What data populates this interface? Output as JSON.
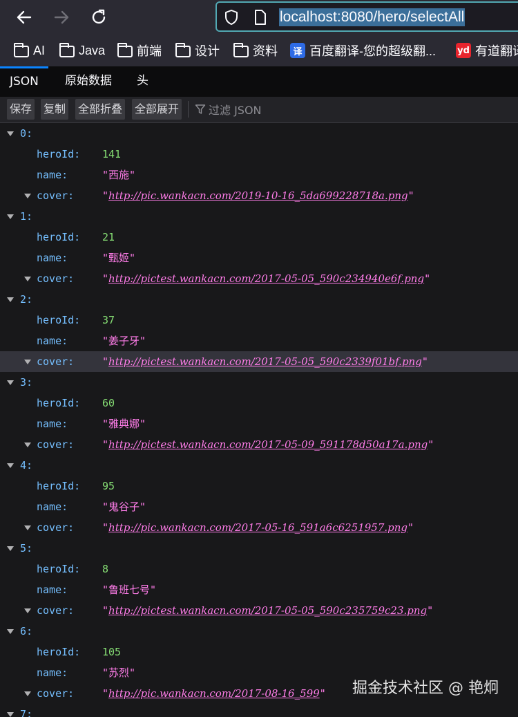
{
  "browser": {
    "url": "localhost:8080/hero/selectAll",
    "bookmarks": [
      {
        "label": "AI",
        "icon": "folder-icon"
      },
      {
        "label": "Java",
        "icon": "folder-icon"
      },
      {
        "label": "前端",
        "icon": "folder-icon"
      },
      {
        "label": "设计",
        "icon": "folder-icon"
      },
      {
        "label": "资料",
        "icon": "folder-icon"
      },
      {
        "label": "百度翻译-您的超级翻...",
        "icon": "baidu-translate-icon",
        "icon_text": "译",
        "color": "#2e6be6"
      },
      {
        "label": "有道翻译",
        "icon": "youdao-icon",
        "icon_text": "yd",
        "color": "#e8242d"
      }
    ]
  },
  "viewer": {
    "tabs": [
      "JSON",
      "原始数据",
      "头"
    ],
    "toolbar": {
      "save": "保存",
      "copy": "复制",
      "collapse_all": "全部折叠",
      "expand_all": "全部展开",
      "filter_placeholder": "过滤 JSON"
    },
    "key_labels": {
      "hero_id": "heroId:",
      "name": "name:",
      "cover": "cover:"
    },
    "entries": [
      {
        "index": "0:",
        "heroId": "141",
        "name": "\"西施\"",
        "cover": "http://pic.wankacn.com/2019-10-16_5da699228718a.png"
      },
      {
        "index": "1:",
        "heroId": "21",
        "name": "\"甄姬\"",
        "cover": "http://pictest.wankacn.com/2017-05-05_590c234940e6f.png"
      },
      {
        "index": "2:",
        "heroId": "37",
        "name": "\"姜子牙\"",
        "cover": "http://pictest.wankacn.com/2017-05-05_590c2339f01bf.png"
      },
      {
        "index": "3:",
        "heroId": "60",
        "name": "\"雅典娜\"",
        "cover": "http://pictest.wankacn.com/2017-05-09_591178d50a17a.png"
      },
      {
        "index": "4:",
        "heroId": "95",
        "name": "\"鬼谷子\"",
        "cover": "http://pic.wankacn.com/2017-05-16_591a6c6251957.png"
      },
      {
        "index": "5:",
        "heroId": "8",
        "name": "\"鲁班七号\"",
        "cover": "http://pictest.wankacn.com/2017-05-05_590c235759c23.png"
      },
      {
        "index": "6:",
        "heroId": "105",
        "name": "\"苏烈\"",
        "cover": "http://pic.wankacn.com/2017-08-16_599"
      }
    ],
    "next_index": "7:",
    "highlighted_entry": 2
  },
  "watermark": "掘金技术社区 @ 艳炯"
}
